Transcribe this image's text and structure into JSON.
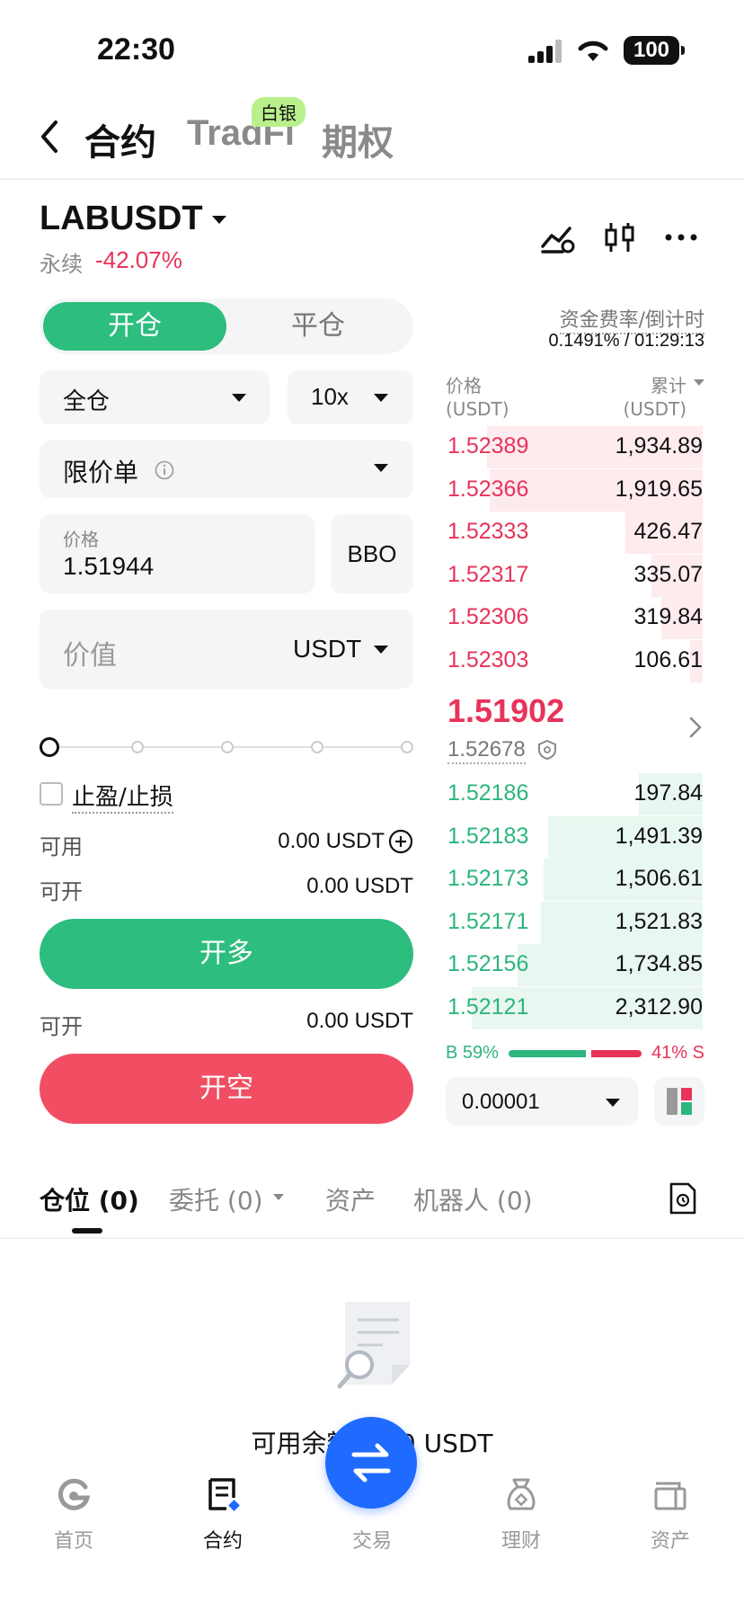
{
  "status_bar": {
    "time": "22:30",
    "battery": "100"
  },
  "top_nav": {
    "tabs": [
      "合约",
      "TradFi",
      "期权"
    ],
    "badge": "白银"
  },
  "symbol": {
    "name": "LABUSDT",
    "type": "永续",
    "change": "-42.07%"
  },
  "order": {
    "open_label": "开仓",
    "close_label": "平仓",
    "margin_mode": "全仓",
    "leverage": "10x",
    "order_type": "限价单",
    "price_label": "价格",
    "price_value": "1.51944",
    "bbo_label": "BBO",
    "value_placeholder": "价值",
    "value_unit": "USDT",
    "tpsl_label": "止盈/止损",
    "available_label": "可用",
    "available_value": "0.00 USDT",
    "can_open_label": "可开",
    "can_open_value_long": "0.00 USDT",
    "can_open_value_short": "0.00 USDT",
    "long_button": "开多",
    "short_button": "开空"
  },
  "orderbook": {
    "funding_label": "资金费率/倒计时",
    "funding_value": "0.1491% / 01:29:13",
    "price_header": "价格",
    "price_unit": "(USDT)",
    "total_header": "累计",
    "total_unit": "(USDT)",
    "asks": [
      {
        "price": "1.52389",
        "total": "1,934.89",
        "depth": 0.84
      },
      {
        "price": "1.52366",
        "total": "1,919.65",
        "depth": 0.83
      },
      {
        "price": "1.52333",
        "total": "426.47",
        "depth": 0.3
      },
      {
        "price": "1.52317",
        "total": "335.07",
        "depth": 0.2
      },
      {
        "price": "1.52306",
        "total": "319.84",
        "depth": 0.16
      },
      {
        "price": "1.52303",
        "total": "106.61",
        "depth": 0.05
      }
    ],
    "last_price": "1.51902",
    "mark_price": "1.52678",
    "bids": [
      {
        "price": "1.52186",
        "total": "197.84",
        "depth": 0.25
      },
      {
        "price": "1.52183",
        "total": "1,491.39",
        "depth": 0.6
      },
      {
        "price": "1.52173",
        "total": "1,506.61",
        "depth": 0.62
      },
      {
        "price": "1.52171",
        "total": "1,521.83",
        "depth": 0.63
      },
      {
        "price": "1.52156",
        "total": "1,734.85",
        "depth": 0.72
      },
      {
        "price": "1.52121",
        "total": "2,312.90",
        "depth": 0.9
      }
    ],
    "buy_ratio": "B 59%",
    "sell_ratio": "41% S",
    "tick_size": "0.00001"
  },
  "position_tabs": [
    {
      "label": "仓位 (0)"
    },
    {
      "label": "委托 (0)"
    },
    {
      "label": "资产"
    },
    {
      "label": "机器人 (0)"
    }
  ],
  "empty_state": {
    "text": "可用余额 0.00 USDT"
  },
  "bottom_nav": [
    {
      "label": "首页",
      "icon": "home-icon"
    },
    {
      "label": "合约",
      "icon": "contract-icon"
    },
    {
      "label": "交易",
      "icon": "trade-swap-icon"
    },
    {
      "label": "理财",
      "icon": "wealth-icon"
    },
    {
      "label": "资产",
      "icon": "assets-wallet-icon"
    }
  ],
  "colors": {
    "green": "#2dbd7e",
    "red": "#f24e63",
    "accent_blue": "#1f6bff"
  }
}
